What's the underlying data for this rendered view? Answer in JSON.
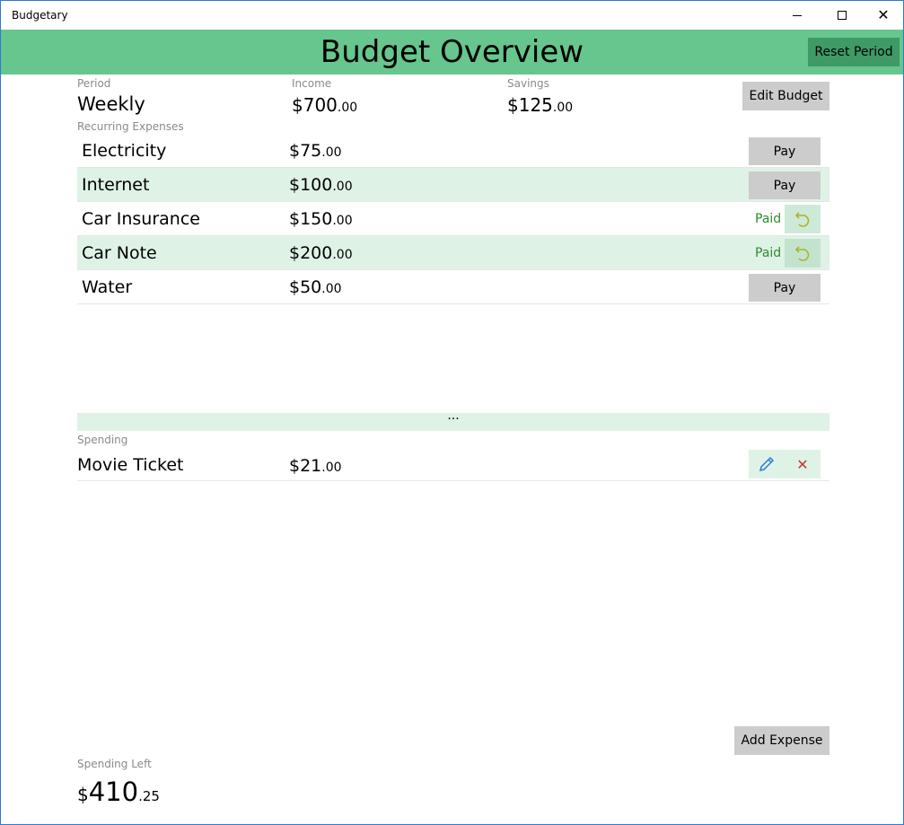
{
  "window": {
    "title": "Budgetary",
    "minimize_icon": "minimize-icon",
    "maximize_icon": "maximize-icon",
    "close_icon": "close-icon"
  },
  "header": {
    "title": "Budget Overview",
    "reset_label": "Reset Period",
    "bg_color": "#66c68d",
    "reset_color": "#3f9a66"
  },
  "summary": {
    "period_label": "Period",
    "period_value": "Weekly",
    "income_label": "Income",
    "income_whole": "$700",
    "income_cents": ".00",
    "savings_label": "Savings",
    "savings_whole": "$125",
    "savings_cents": ".00",
    "edit_budget_label": "Edit Budget"
  },
  "recurring": {
    "section_label": "Recurring Expenses",
    "items": [
      {
        "name": "Electricity",
        "whole": "$75",
        "cents": ".00",
        "status": "unpaid",
        "action_label": "Pay"
      },
      {
        "name": "Internet",
        "whole": "$100",
        "cents": ".00",
        "status": "unpaid",
        "action_label": "Pay"
      },
      {
        "name": "Car Insurance",
        "whole": "$150",
        "cents": ".00",
        "status": "paid",
        "paid_label": "Paid"
      },
      {
        "name": "Car Note",
        "whole": "$200",
        "cents": ".00",
        "status": "paid",
        "paid_label": "Paid"
      },
      {
        "name": "Water",
        "whole": "$50",
        "cents": ".00",
        "status": "unpaid",
        "action_label": "Pay"
      }
    ],
    "expander_glyph": "···"
  },
  "spending": {
    "section_label": "Spending",
    "items": [
      {
        "name": "Movie Ticket",
        "whole": "$21",
        "cents": ".00"
      }
    ],
    "add_expense_label": "Add Expense"
  },
  "spending_left": {
    "label": "Spending Left",
    "symbol": "$",
    "whole": "410",
    "cents": ".25"
  },
  "colors": {
    "accent": "#66c68d",
    "row_alt": "#dff2e6",
    "paid_text": "#2e8b2e",
    "undo_icon": "#a8b820",
    "edit_icon": "#2b7bd6",
    "delete_icon": "#c0392b"
  }
}
